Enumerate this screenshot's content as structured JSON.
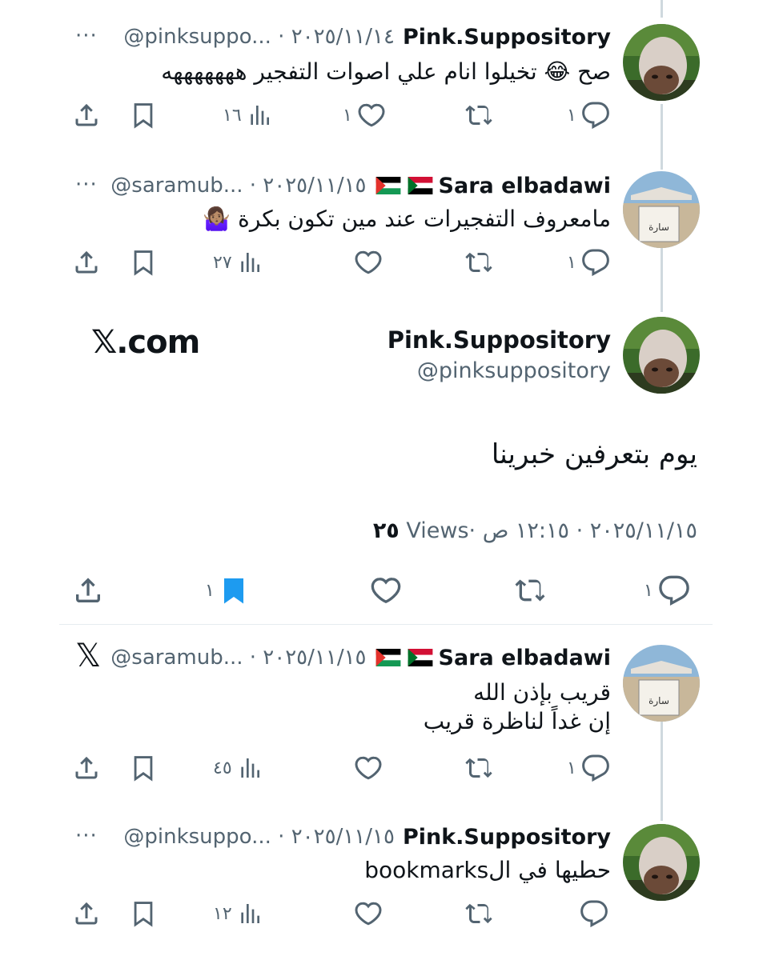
{
  "colors": {
    "accent": "#1d9bf0",
    "muted": "#536471",
    "text": "#0f1419",
    "thread": "#cfd9de"
  },
  "tweets": [
    {
      "name": "Pink.Suppository",
      "meta": "@pinksuppo... · ٢٠٢٥/١١/١٤",
      "text": [
        "صح 😂 تخيلوا انام علي اصوات التفجير هههههههه"
      ],
      "replies": "١",
      "retweets": "",
      "likes": "١",
      "views": "١٦"
    },
    {
      "name": "Sara elbadawi",
      "meta": "@saramub... · ٢٠٢٥/١١/١٥",
      "text": [
        "مامعروف التفجيرات عند مين تكون بكرة 🤷🏽‍♀️"
      ],
      "replies": "١",
      "retweets": "",
      "likes": "",
      "views": "٢٧"
    },
    {
      "name": "Sara elbadawi",
      "meta": "@saramub... · ٢٠٢٥/١١/١٥",
      "text": [
        "قريب بإذن الله",
        "إن غداً لناظرة قريب"
      ],
      "replies": "١",
      "retweets": "",
      "likes": "",
      "views": "٤٥"
    },
    {
      "name": "Pink.Suppository",
      "meta": "@pinksuppo... · ٢٠٢٥/١١/١٥",
      "text": [
        "حطيها في الbookmarks"
      ],
      "replies": "",
      "retweets": "",
      "likes": "",
      "views": "١٢"
    }
  ],
  "main": {
    "name": "Pink.Suppository",
    "handle": "@pinksuppository",
    "text": "يوم بتعرفين خبرينا",
    "date": "٢٠٢٥/١١/١٥ · ١٢:١٥ ص · ",
    "views_count": "٢٥",
    "views_label": " Views",
    "replies": "١",
    "bookmarks": "١",
    "watermark": "𝕏.com"
  },
  "labels": {
    "more": "···",
    "x_logo": "𝕏"
  }
}
